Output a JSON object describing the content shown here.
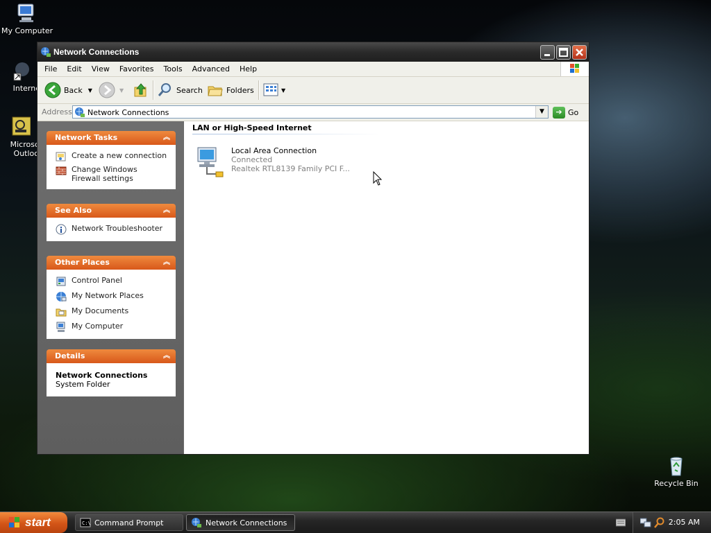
{
  "desktop": {
    "icons": [
      {
        "name": "My Computer"
      },
      {
        "name": "Interne"
      },
      {
        "name": "Microsc\nOutloo"
      },
      {
        "name": "Recycle Bin"
      }
    ]
  },
  "window": {
    "title": "Network Connections",
    "menu": [
      "File",
      "Edit",
      "View",
      "Favorites",
      "Tools",
      "Advanced",
      "Help"
    ],
    "toolbar": {
      "back_label": "Back",
      "search_label": "Search",
      "folders_label": "Folders"
    },
    "address": {
      "label": "Address",
      "value": "Network Connections",
      "go_label": "Go"
    },
    "left_pane": {
      "network_tasks": {
        "title": "Network Tasks",
        "items": [
          "Create a new connection",
          "Change Windows Firewall settings"
        ]
      },
      "see_also": {
        "title": "See Also",
        "items": [
          "Network Troubleshooter"
        ]
      },
      "other_places": {
        "title": "Other Places",
        "items": [
          "Control Panel",
          "My Network Places",
          "My Documents",
          "My Computer"
        ]
      },
      "details": {
        "title": "Details",
        "name": "Network Connections",
        "type": "System Folder"
      }
    },
    "content": {
      "group_header": "LAN or High-Speed Internet",
      "connection": {
        "name": "Local Area Connection",
        "status": "Connected",
        "device": "Realtek RTL8139 Family PCI F..."
      }
    }
  },
  "taskbar": {
    "start_label": "start",
    "tasks": [
      {
        "label": "Command Prompt",
        "active": false
      },
      {
        "label": "Network Connections",
        "active": true
      }
    ],
    "clock": "2:05 AM"
  },
  "colors": {
    "panel_header": "#d8581a",
    "start_button": "#d35518"
  }
}
